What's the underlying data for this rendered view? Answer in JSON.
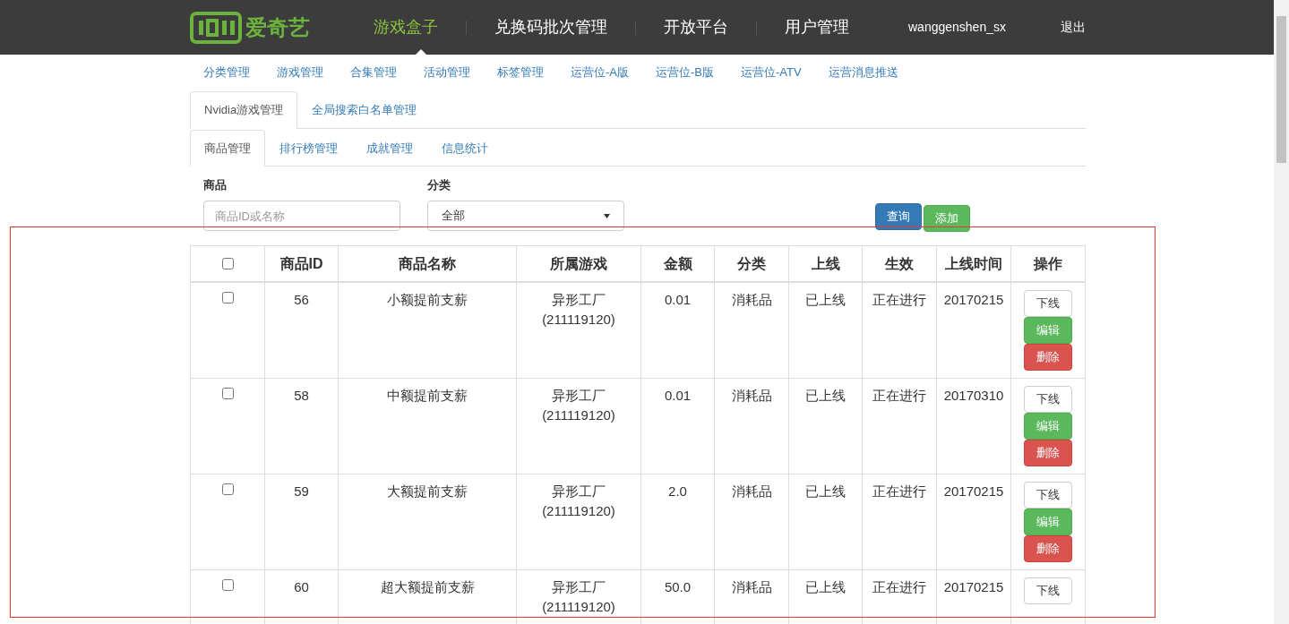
{
  "header": {
    "logo": "爱奇艺",
    "nav": [
      {
        "label": "游戏盒子",
        "selected": true
      },
      {
        "label": "兑换码批次管理",
        "selected": false
      },
      {
        "label": "开放平台",
        "selected": false
      },
      {
        "label": "用户管理",
        "selected": false
      }
    ],
    "user": "wanggenshen_sx",
    "logout": "退出"
  },
  "subnav": [
    "分类管理",
    "游戏管理",
    "合集管理",
    "活动管理",
    "标签管理",
    "运营位-A版",
    "运营位-B版",
    "运营位-ATV",
    "运营消息推送"
  ],
  "tabs": [
    {
      "label": "Nvidia游戏管理",
      "selected": true
    },
    {
      "label": "全局搜索白名单管理",
      "selected": false
    }
  ],
  "subtabs": [
    {
      "label": "商品管理",
      "selected": true
    },
    {
      "label": "排行榜管理",
      "selected": false
    },
    {
      "label": "成就管理",
      "selected": false
    },
    {
      "label": "信息统计",
      "selected": false
    }
  ],
  "filters": {
    "product_label": "商品",
    "product_placeholder": "商品ID或名称",
    "category_label": "分类",
    "category_value": "全部",
    "query": "查询",
    "add": "添加"
  },
  "table": {
    "select_all": {
      "checked": false
    },
    "columns": [
      "商品ID",
      "商品名称",
      "所属游戏",
      "金额",
      "分类",
      "上线",
      "生效",
      "上线时间",
      "操作"
    ],
    "rows": [
      {
        "checked": false,
        "cells": [
          "56",
          "小额提前支薪",
          "异形工厂\n(211119120)",
          "0.01",
          "消耗品",
          "已上线",
          "正在进行",
          "20170215"
        ],
        "actions": [
          {
            "kind": "plain",
            "label": "下线"
          },
          {
            "kind": "success",
            "label": "编辑"
          },
          {
            "kind": "danger",
            "label": "删除"
          }
        ]
      },
      {
        "checked": false,
        "cells": [
          "58",
          "中额提前支薪",
          "异形工厂\n(211119120)",
          "0.01",
          "消耗品",
          "已上线",
          "正在进行",
          "20170310"
        ],
        "actions": [
          {
            "kind": "plain",
            "label": "下线"
          },
          {
            "kind": "success",
            "label": "编辑"
          },
          {
            "kind": "danger",
            "label": "删除"
          }
        ]
      },
      {
        "checked": false,
        "cells": [
          "59",
          "大额提前支薪",
          "异形工厂\n(211119120)",
          "2.0",
          "消耗品",
          "已上线",
          "正在进行",
          "20170215"
        ],
        "actions": [
          {
            "kind": "plain",
            "label": "下线"
          },
          {
            "kind": "success",
            "label": "编辑"
          },
          {
            "kind": "danger",
            "label": "删除"
          }
        ]
      },
      {
        "checked": false,
        "cells": [
          "60",
          "超大额提前支薪",
          "异形工厂\n(211119120)",
          "50.0",
          "消耗品",
          "已上线",
          "正在进行",
          "20170215"
        ],
        "actions": [
          {
            "kind": "plain",
            "label": "下线"
          }
        ]
      }
    ]
  }
}
